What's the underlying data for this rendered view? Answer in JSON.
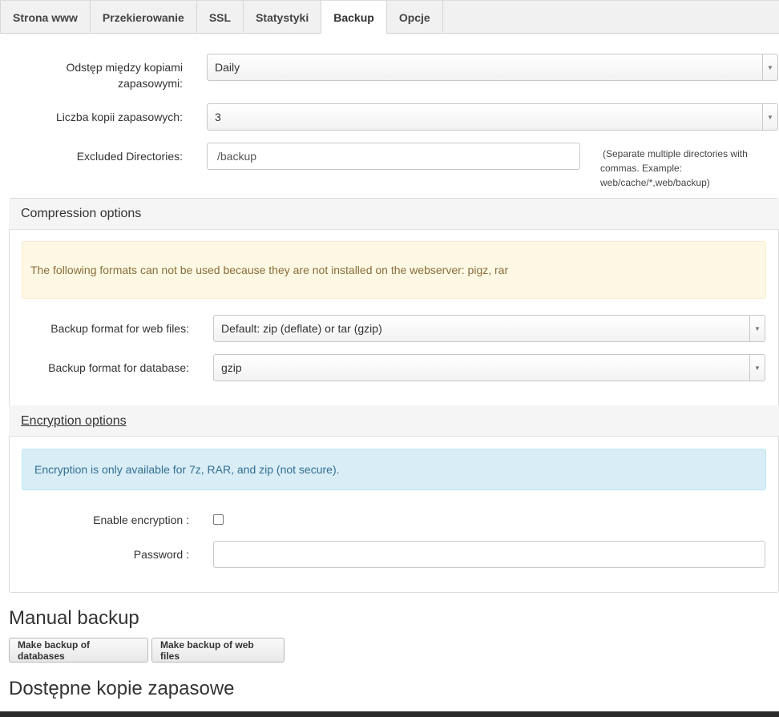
{
  "tabs": [
    {
      "label": "Strona www",
      "active": false
    },
    {
      "label": "Przekierowanie",
      "active": false
    },
    {
      "label": "SSL",
      "active": false
    },
    {
      "label": "Statystyki",
      "active": false
    },
    {
      "label": "Backup",
      "active": true
    },
    {
      "label": "Opcje",
      "active": false
    }
  ],
  "form": {
    "interval_label_line1": "Odstęp między kopiami",
    "interval_label_line2": "zapasowymi:",
    "interval_value": "Daily",
    "copies_label": "Liczba kopii zapasowych:",
    "copies_value": "3",
    "excluded_label": "Excluded Directories:",
    "excluded_value": "/backup",
    "excluded_hint_line1": "(Separate multiple directories with",
    "excluded_hint_line2": "commas. Example:",
    "excluded_hint_line3": "web/cache/*,web/backup)"
  },
  "compression": {
    "title": "Compression options",
    "warning": "The following formats can not be used because they are not installed on the webserver: pigz, rar",
    "web_label": "Backup format for web files:",
    "web_value": "Default: zip (deflate) or tar (gzip)",
    "db_label": "Backup format for database:",
    "db_value": "gzip"
  },
  "encryption": {
    "title": "Encryption options",
    "info": "Encryption is only available for 7z, RAR, and zip (not secure).",
    "enable_label": "Enable encryption :",
    "enabled": false,
    "password_label": "Password :",
    "password_value": ""
  },
  "manual": {
    "title": "Manual backup",
    "db_button": "Make backup of databases",
    "web_button": "Make backup of web files"
  },
  "available": {
    "title": "Dostępne kopie zapasowe"
  },
  "colors": {
    "warning_bg": "#fcf8e3",
    "warning_text": "#8a6d3b",
    "info_bg": "#d9edf7",
    "info_text": "#31708f"
  }
}
